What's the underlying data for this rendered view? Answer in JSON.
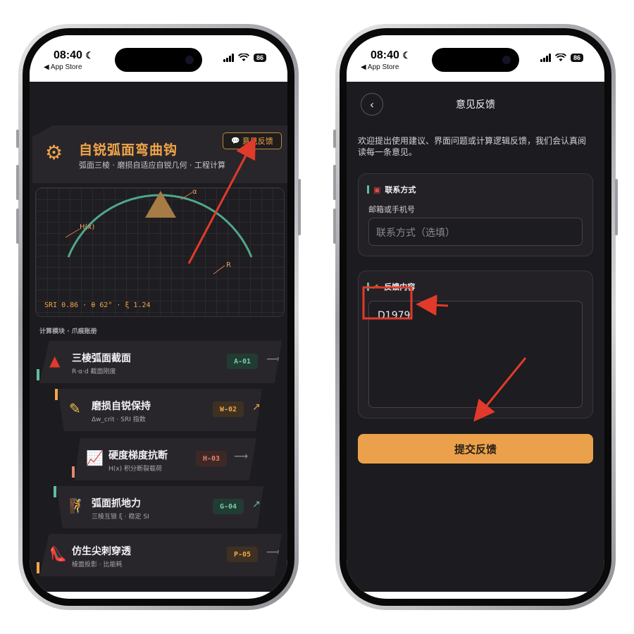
{
  "status": {
    "time": "08:40",
    "back_app": "◀ App Store",
    "battery": "86"
  },
  "left": {
    "hero_title": "自锐弧面弯曲钩",
    "hero_subtitle": "弧面三棱 · 磨损自适应自锐几何 · 工程计算",
    "feedback_button": "意见反馈",
    "canvas_labels": {
      "h": "H(x)",
      "alpha": "α",
      "r": "R"
    },
    "readout": "SRI 0.86 · θ 62° · ξ 1.24",
    "section_title": "计算模块 · 爪痕账册",
    "modules": [
      {
        "icon": "triangle-icon",
        "title": "三棱弧面截面",
        "sub": "R·α·d 截面刚度",
        "code": "A-01",
        "arrow": "⟶",
        "accent": "#5fbf9b",
        "code_bg": "#223b33",
        "code_fg": "#6fd0a9"
      },
      {
        "icon": "pencil-icon",
        "title": "磨损自锐保持",
        "sub": "Δw_crit · SRI 指数",
        "code": "W-02",
        "arrow": "↗",
        "accent": "#f2a64a",
        "code_bg": "#3e3122",
        "code_fg": "#f2a64a"
      },
      {
        "icon": "chart-icon",
        "title": "硬度梯度抗断",
        "sub": "H(x) 积分断裂载荷",
        "code": "H-03",
        "arrow": "⟶",
        "accent": "#e08a6a",
        "code_bg": "#3e2826",
        "code_fg": "#e6826a"
      },
      {
        "icon": "climber-icon",
        "title": "弧面抓地力",
        "sub": "三棱互锁 ξ · 稳定 SI",
        "code": "G-04",
        "arrow": "↗",
        "accent": "#5fbf9b",
        "code_bg": "#223b33",
        "code_fg": "#6fd0a9"
      },
      {
        "icon": "heel-icon",
        "title": "仿生尖刺穿透",
        "sub": "棱面投影 · 比能耗",
        "code": "P-05",
        "arrow": "⟶",
        "accent": "#f2a64a",
        "code_bg": "#3e3122",
        "code_fg": "#f2a64a"
      }
    ]
  },
  "right": {
    "nav_title": "意见反馈",
    "intro": "欢迎提出使用建议、界面问题或计算逻辑反馈，我们会认真阅读每一条意见。",
    "contact": {
      "title": "联系方式",
      "label": "邮箱或手机号",
      "placeholder": "联系方式（选填）"
    },
    "content": {
      "title": "反馈内容",
      "value": "D1979"
    },
    "submit": "提交反馈"
  },
  "colors": {
    "accent": "#f2a64a",
    "background": "#1c1b1f",
    "highlight": "#e23a2a"
  }
}
